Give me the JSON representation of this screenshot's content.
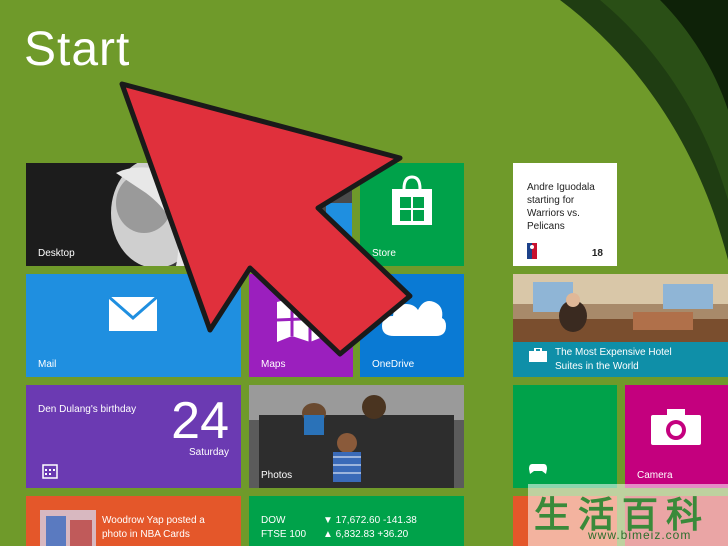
{
  "start_title": "Start",
  "tiles": {
    "desktop": {
      "label": "Desktop"
    },
    "store": {
      "label": "Store"
    },
    "mail": {
      "label": "Mail"
    },
    "maps": {
      "label": "Maps"
    },
    "onedrive": {
      "label": "OneDrive"
    },
    "photos": {
      "label": "Photos"
    },
    "camera": {
      "label": "Camera"
    },
    "calendar": {
      "event": "Den Dulang's birthday",
      "day": "24",
      "weekday": "Saturday"
    },
    "sports_news": {
      "line1": "Andre Iguodala",
      "line2": "starting for",
      "line3": "Warriors vs.",
      "line4": "Pelicans",
      "count": "18"
    },
    "travel": {
      "line1": "The Most Expensive Hotel",
      "line2": "Suites in the World"
    },
    "people": {
      "line1": "Woodrow Yap posted a",
      "line2": "photo in NBA Cards"
    },
    "finance": {
      "rows": [
        {
          "name": "DOW",
          "value": "▼ 17,672.60 -141.38"
        },
        {
          "name": "FTSE 100",
          "value": "▲ 6,832.83 +36.20"
        }
      ]
    }
  },
  "watermark": {
    "chars": "生活百科",
    "url": "www.bimeiz.com"
  },
  "colors": {
    "background": "#6f9a2a",
    "store": "#00a24a",
    "mail": "#1f8fe0",
    "maps": "#9b1fbe",
    "onedrive": "#0a7ad4",
    "calendar": "#6b3ab2",
    "travel": "#0f8fa8",
    "camera": "#c4007e",
    "finance": "#00a24a",
    "people": "#e4572a",
    "arrow": "#e0303c"
  }
}
